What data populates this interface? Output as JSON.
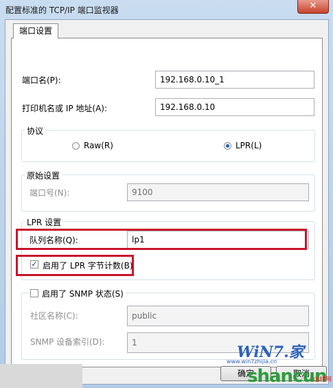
{
  "window": {
    "title": "配置标准的 TCP/IP 端口监视器",
    "close_glyph": "✕"
  },
  "tab": {
    "label": "端口设置"
  },
  "port": {
    "name_label": "端口名(P):",
    "name_value": "192.168.0.10_1",
    "addr_label": "打印机名或 IP 地址(A):",
    "addr_value": "192.168.0.10"
  },
  "protocol": {
    "title": "协议",
    "raw_label": "Raw(R)",
    "lpr_label": "LPR(L)",
    "selected": "LPR"
  },
  "raw_settings": {
    "title": "原始设置",
    "port_num_label": "端口号(N):",
    "port_num_value": "9100"
  },
  "lpr_settings": {
    "title": "LPR 设置",
    "queue_label": "队列名称(Q):",
    "queue_value": "lp1",
    "byte_count_label": "启用了 LPR 字节计数(B)",
    "byte_count_checked": true
  },
  "snmp": {
    "enable_label": "启用了 SNMP 状态(S)",
    "enabled": false,
    "community_label": "社区名称(C):",
    "community_value": "public",
    "index_label": "SNMP 设备索引(D):",
    "index_value": "1"
  },
  "buttons": {
    "ok": "确定",
    "cancel": "取消"
  },
  "watermark": {
    "logo": "WiN7.家",
    "url": "www.win7zhijia.cn",
    "shancun": "shancun",
    "shancun_cn": "山村网"
  },
  "colors": {
    "highlight_box": "#c8142c",
    "title_bar": "#c9dcf0"
  }
}
